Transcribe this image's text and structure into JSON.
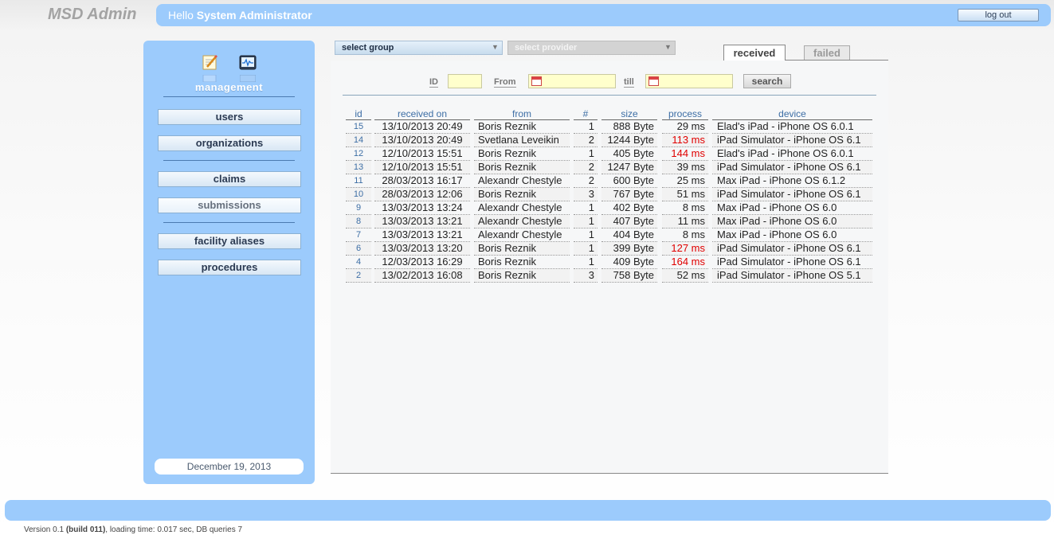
{
  "app": {
    "title": "MSD Admin"
  },
  "header": {
    "greeting_prefix": "Hello",
    "user_name": "System Administrator",
    "logout_label": "log out"
  },
  "sidebar": {
    "section_label": "management",
    "icons": [
      "management-icon",
      "monitor-icon"
    ],
    "items": [
      {
        "label": "users",
        "active": false
      },
      {
        "label": "organizations",
        "active": false
      },
      {
        "label": "claims",
        "active": false
      },
      {
        "label": "submissions",
        "active": true
      },
      {
        "label": "facility aliases",
        "active": false
      },
      {
        "label": "procedures",
        "active": false
      }
    ],
    "date": "December 19, 2013"
  },
  "filters": {
    "group_select": "select group",
    "provider_select": "select provider",
    "id_label": "ID",
    "from_label": "From",
    "till_label": "till",
    "search_label": "search"
  },
  "tabs": [
    {
      "label": "received",
      "active": true
    },
    {
      "label": "failed",
      "active": false
    }
  ],
  "table": {
    "headers": [
      "id",
      "received on",
      "from",
      "#",
      "size",
      "process",
      "device"
    ],
    "rows": [
      {
        "id": "15",
        "received_on": "13/10/2013 20:49",
        "from": "Boris Reznik",
        "count": "1",
        "size": "888 Byte",
        "process": "29 ms",
        "slow": false,
        "device": "Elad's iPad - iPhone OS 6.0.1"
      },
      {
        "id": "14",
        "received_on": "13/10/2013 20:49",
        "from": "Svetlana Leveikin",
        "count": "2",
        "size": "1244 Byte",
        "process": "113 ms",
        "slow": true,
        "device": "iPad Simulator - iPhone OS 6.1"
      },
      {
        "id": "12",
        "received_on": "12/10/2013 15:51",
        "from": "Boris Reznik",
        "count": "1",
        "size": "405 Byte",
        "process": "144 ms",
        "slow": true,
        "device": "Elad's iPad - iPhone OS 6.0.1"
      },
      {
        "id": "13",
        "received_on": "12/10/2013 15:51",
        "from": "Boris Reznik",
        "count": "2",
        "size": "1247 Byte",
        "process": "39 ms",
        "slow": false,
        "device": "iPad Simulator - iPhone OS 6.1"
      },
      {
        "id": "11",
        "received_on": "28/03/2013 16:17",
        "from": "Alexandr Chestyle",
        "count": "2",
        "size": "600 Byte",
        "process": "25 ms",
        "slow": false,
        "device": "Max iPad - iPhone OS 6.1.2"
      },
      {
        "id": "10",
        "received_on": "28/03/2013 12:06",
        "from": "Boris Reznik",
        "count": "3",
        "size": "767 Byte",
        "process": "51 ms",
        "slow": false,
        "device": "iPad Simulator - iPhone OS 6.1"
      },
      {
        "id": "9",
        "received_on": "13/03/2013 13:24",
        "from": "Alexandr Chestyle",
        "count": "1",
        "size": "402 Byte",
        "process": "8 ms",
        "slow": false,
        "device": "Max iPad - iPhone OS 6.0"
      },
      {
        "id": "8",
        "received_on": "13/03/2013 13:21",
        "from": "Alexandr Chestyle",
        "count": "1",
        "size": "407 Byte",
        "process": "11 ms",
        "slow": false,
        "device": "Max iPad - iPhone OS 6.0"
      },
      {
        "id": "7",
        "received_on": "13/03/2013 13:21",
        "from": "Alexandr Chestyle",
        "count": "1",
        "size": "404 Byte",
        "process": "8 ms",
        "slow": false,
        "device": "Max iPad - iPhone OS 6.0"
      },
      {
        "id": "6",
        "received_on": "13/03/2013 13:20",
        "from": "Boris Reznik",
        "count": "1",
        "size": "399 Byte",
        "process": "127 ms",
        "slow": true,
        "device": "iPad Simulator - iPhone OS 6.1"
      },
      {
        "id": "4",
        "received_on": "12/03/2013 16:29",
        "from": "Boris Reznik",
        "count": "1",
        "size": "409 Byte",
        "process": "164 ms",
        "slow": true,
        "device": "iPad Simulator - iPhone OS 6.1"
      },
      {
        "id": "2",
        "received_on": "13/02/2013 16:08",
        "from": "Boris Reznik",
        "count": "3",
        "size": "758 Byte",
        "process": "52 ms",
        "slow": false,
        "device": "iPad Simulator - iPhone OS 5.1"
      }
    ]
  },
  "footer": {
    "version_prefix": "Version 0.1",
    "build": "(build 011)",
    "stats": ", loading time: 0.017 sec, DB queries 7"
  },
  "colors": {
    "accent": "#9ccbfc",
    "slow_process": "#e00000",
    "link": "#3d6ea5",
    "date_input_bg": "#ffffcc"
  }
}
